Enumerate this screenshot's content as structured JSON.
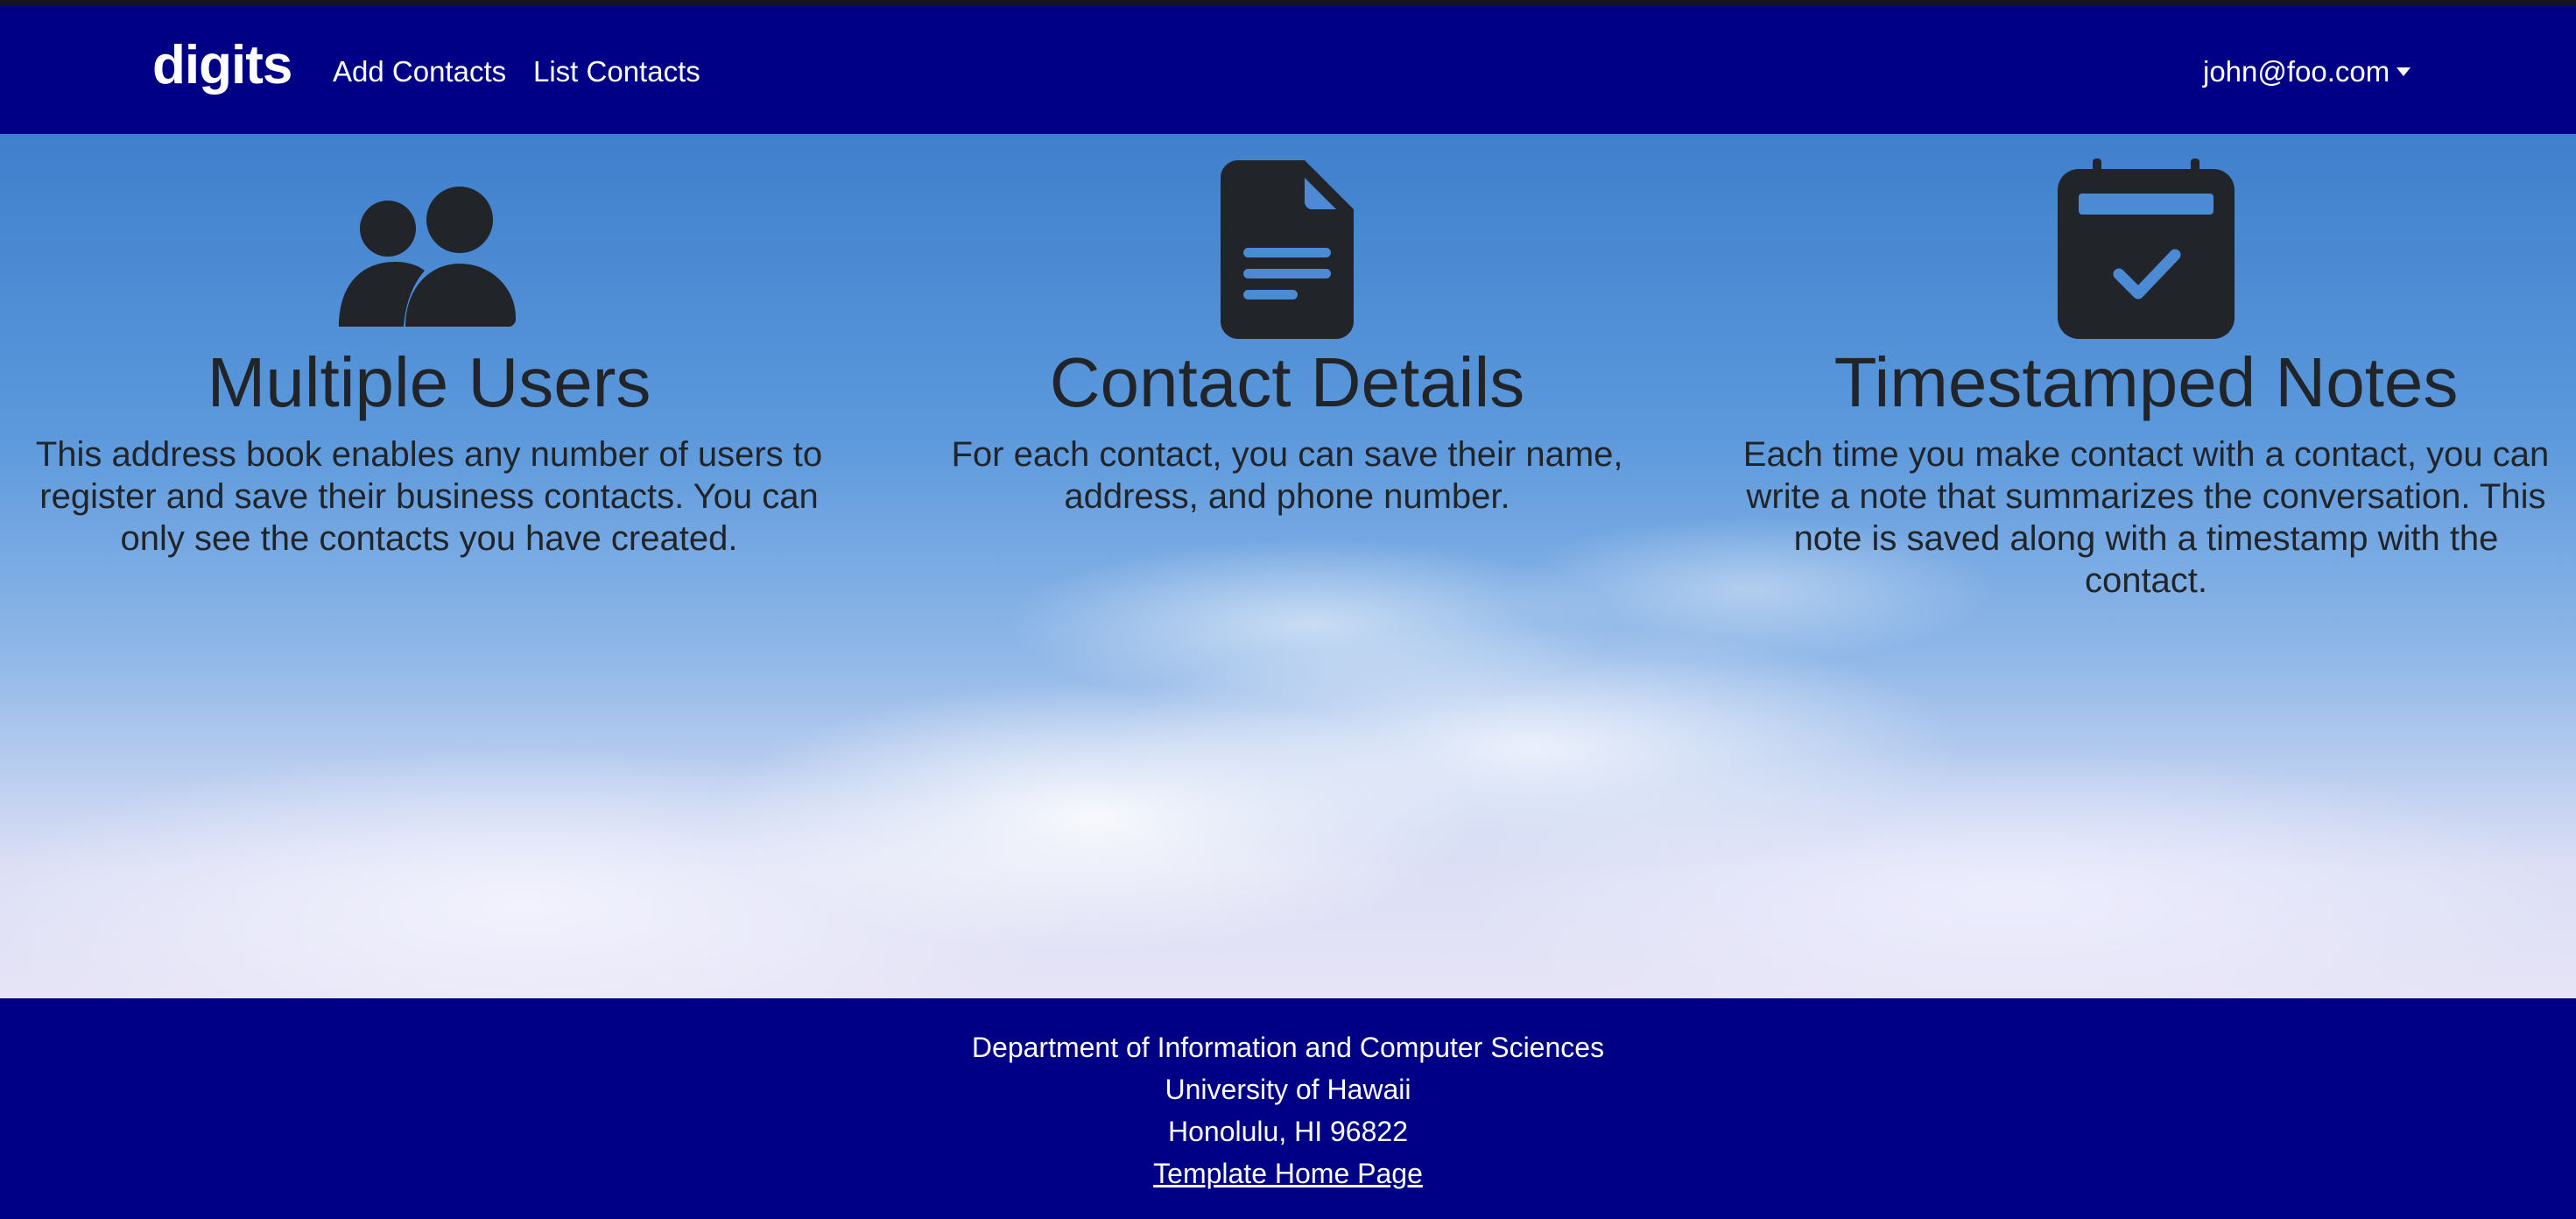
{
  "navbar": {
    "brand": "digits",
    "links": [
      "Add Contacts",
      "List Contacts"
    ],
    "user": "john@foo.com",
    "background_color": "#000087"
  },
  "features": [
    {
      "icon": "users-icon",
      "title": "Multiple Users",
      "text": "This address book enables any number of users to register and save their business contacts. You can only see the contacts you have created."
    },
    {
      "icon": "file-lines-icon",
      "title": "Contact Details",
      "text": "For each contact, you can save their name, address, and phone number."
    },
    {
      "icon": "calendar-check-icon",
      "title": "Timestamped Notes",
      "text": "Each time you make contact with a contact, you can write a note that summarizes the conversation. This note is saved along with a timestamp with the contact."
    }
  ],
  "footer": {
    "lines": [
      "Department of Information and Computer Sciences",
      "University of Hawaii",
      "Honolulu, HI 96822"
    ],
    "link_label": "Template Home Page"
  }
}
